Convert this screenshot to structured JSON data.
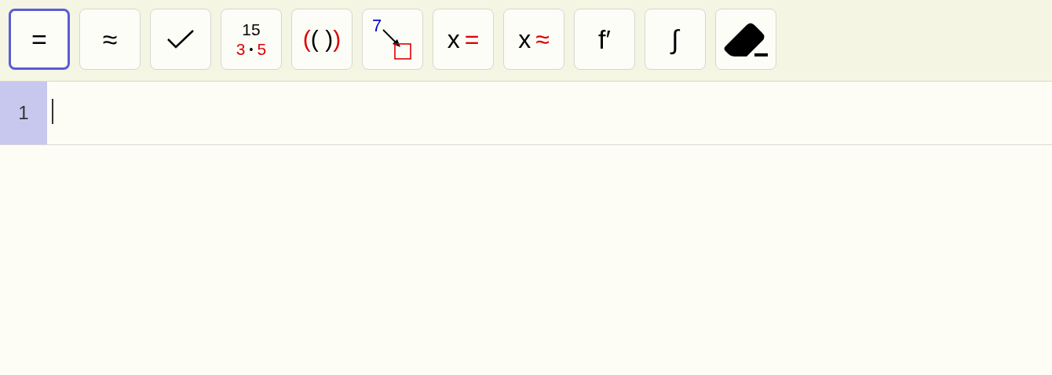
{
  "toolbar": {
    "tools": [
      {
        "kind": "symbol",
        "symbol": "=",
        "selected": true
      },
      {
        "kind": "symbol",
        "symbol": "≈",
        "selected": false
      },
      {
        "kind": "check",
        "selected": false
      },
      {
        "kind": "factor",
        "product": "15",
        "factors": [
          "3",
          "5"
        ],
        "separator": "•",
        "selected": false
      },
      {
        "kind": "parens",
        "outer_open": "(",
        "inner": "( )",
        "outer_close": ")",
        "selected": false
      },
      {
        "kind": "substitute",
        "value": "7",
        "selected": false
      },
      {
        "kind": "solve",
        "variable": "x",
        "symbol": "=",
        "selected": false
      },
      {
        "kind": "solve",
        "variable": "x",
        "symbol": "≈",
        "selected": false
      },
      {
        "kind": "symbol",
        "symbol": "f′",
        "selected": false
      },
      {
        "kind": "symbol",
        "symbol": "∫",
        "selected": false
      },
      {
        "kind": "eraser",
        "selected": false
      }
    ]
  },
  "rows": [
    {
      "number": "1",
      "selected": true
    }
  ]
}
